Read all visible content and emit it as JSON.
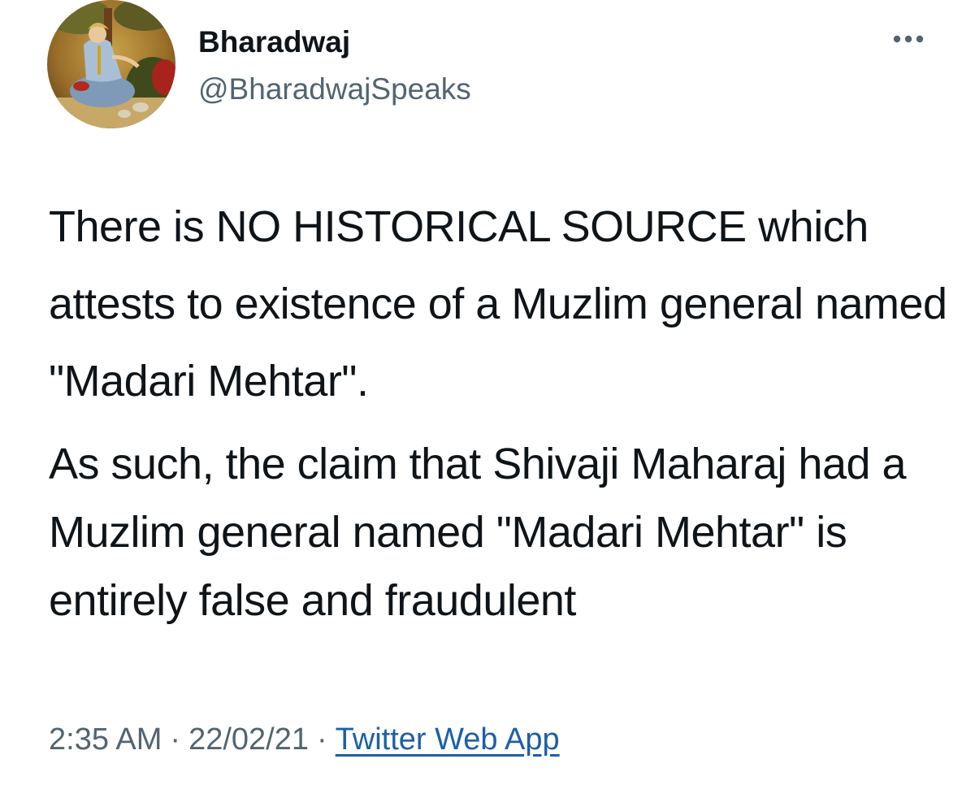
{
  "author": {
    "display_name": "Bharadwaj",
    "handle": "@BharadwajSpeaks",
    "avatar_icon": "miniature-painting-avatar"
  },
  "more_icon": "more-horizontal-icon",
  "tweet": {
    "paragraphs": [
      "There is NO HISTORICAL SOURCE which attests to existence of a Muzlim general named \"Madari Mehtar\".",
      "As such, the claim that Shivaji Maharaj had a Muzlim general named \"Madari Mehtar\" is entirely false and fraudulent"
    ],
    "time": "2:35 AM",
    "date": "22/02/21",
    "separator": "·",
    "source": "Twitter Web App"
  },
  "colors": {
    "text": "#0f1419",
    "secondary": "#536471",
    "link": "#1d5fa8"
  }
}
